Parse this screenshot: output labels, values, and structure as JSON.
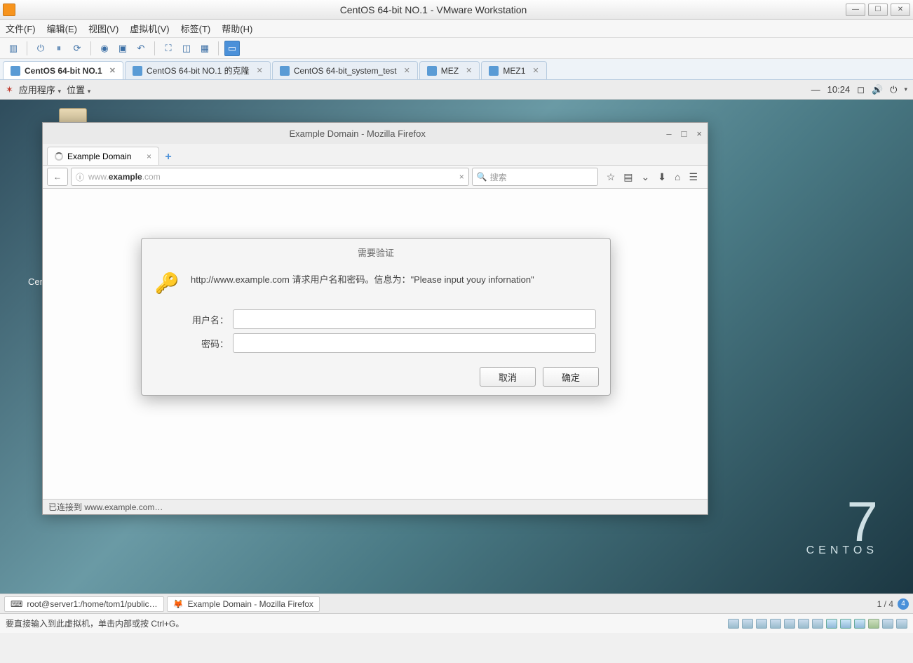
{
  "vmware": {
    "title": "CentOS 64-bit NO.1 - VMware Workstation",
    "menu": {
      "file": "文件(F)",
      "edit": "编辑(E)",
      "view": "视图(V)",
      "vm": "虚拟机(V)",
      "tags": "标签(T)",
      "help": "帮助(H)"
    },
    "tabs": [
      {
        "label": "CentOS 64-bit NO.1",
        "active": true
      },
      {
        "label": "CentOS 64-bit NO.1 的克隆",
        "active": false
      },
      {
        "label": "CentOS 64-bit_system_test",
        "active": false
      },
      {
        "label": "MEZ",
        "active": false
      },
      {
        "label": "MEZ1",
        "active": false
      }
    ],
    "footer_hint": "要直接输入到此虚拟机，单击内部或按 Ctrl+G。"
  },
  "gnome": {
    "apps": "应用程序",
    "places": "位置",
    "clock": "10:24",
    "taskbar": {
      "terminal": "root@server1:/home/tom1/public…",
      "firefox": "Example Domain - Mozilla Firefox",
      "workspace": "1 / 4",
      "ws_badge": "4"
    }
  },
  "desktop": {
    "left_label": "Cer"
  },
  "centos_logo": {
    "seven": "7",
    "name": "CENTOS"
  },
  "firefox": {
    "window_title": "Example Domain - Mozilla Firefox",
    "tab_title": "Example Domain",
    "url_display": "www.example.com",
    "search_placeholder": "搜索",
    "status": "已连接到 www.example.com…",
    "auth": {
      "title": "需要验证",
      "message": "http://www.example.com 请求用户名和密码。信息为：\"Please input youy infornation\"",
      "user_label": "用户名：",
      "pass_label": "密码：",
      "cancel": "取消",
      "ok": "确定"
    }
  }
}
